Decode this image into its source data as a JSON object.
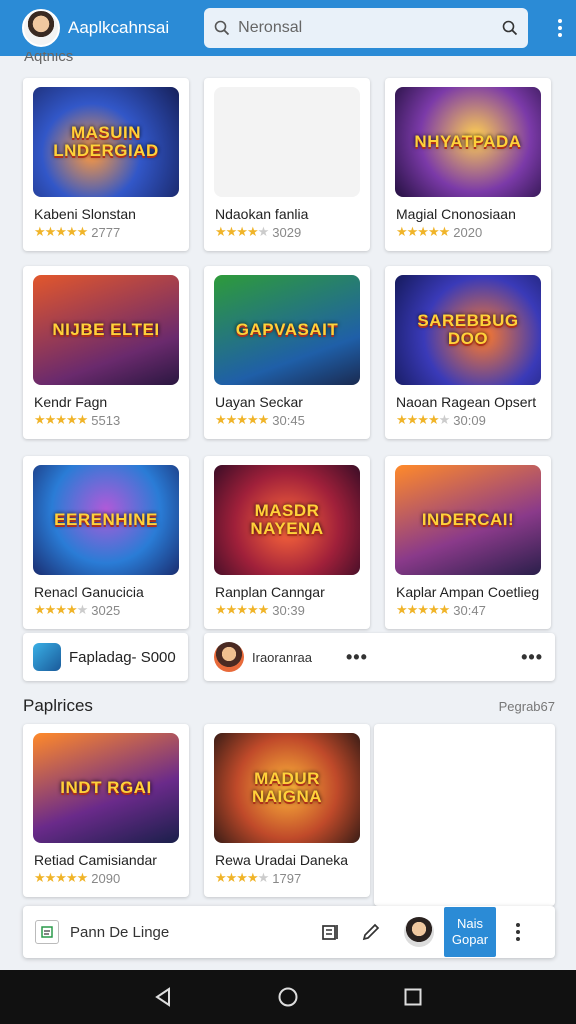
{
  "app": {
    "title": "Aaplkcahnsai"
  },
  "search": {
    "placeholder": "Neronsal"
  },
  "partial_section_title": "Aqtnics",
  "games": [
    {
      "thumb_text": "MASUIN LNDERGIAD",
      "name": "Kabeni Slonstan",
      "rating": 5,
      "count": "2777"
    },
    {
      "thumb_text": "",
      "name": "Ndaokan fanlia",
      "rating": 3.5,
      "count": "3029"
    },
    {
      "thumb_text": "NHYATPADA",
      "name": "Magial Cnonosiaan",
      "rating": 5,
      "count": "2020"
    },
    {
      "thumb_text": "NIJBE ELTEI",
      "name": "Kendr Fagn",
      "rating": 5,
      "count": "5513"
    },
    {
      "thumb_text": "GAPVASAIT",
      "name": "Uayan Seckar",
      "rating": 5,
      "count": "30:45"
    },
    {
      "thumb_text": "SAREBBUG DOO",
      "name": "Naoan Ragean Opsert",
      "rating": 3.5,
      "count": "30:09"
    },
    {
      "thumb_text": "EERENHINE",
      "name": "Renacl Ganucicia",
      "rating": 3.5,
      "count": "3025"
    },
    {
      "thumb_text": "MASDR NAYENA",
      "name": "Ranplan Canngar",
      "rating": 5,
      "count": "30:39"
    },
    {
      "thumb_text": "INDERCAI!",
      "name": "Kaplar Ampan Coetlieg",
      "rating": 5,
      "count": "30:47"
    }
  ],
  "overlay": {
    "left_label": "Fapladag- S000",
    "mid_label": "Iraoranraa"
  },
  "section2": {
    "title": "Paplrices",
    "link": "Pegrab67"
  },
  "games2": [
    {
      "thumb_text": "INDT RGAI",
      "name": "Retiad Camisiandar",
      "rating": 5,
      "count": "2090"
    },
    {
      "thumb_text": "MADUR NAIGNA",
      "name": "Rewa Uradai Daneka",
      "rating": 4,
      "count": "1797"
    }
  ],
  "bottom_bar": {
    "label": "Pann De Linge",
    "primary_button": "Nais Gopar"
  },
  "icons": {
    "search": "search-icon",
    "menu": "kebab-menu-icon",
    "back": "back-triangle-icon",
    "home": "home-circle-icon",
    "recents": "recents-square-icon"
  },
  "colors": {
    "accent": "#2b8bd6",
    "star": "#f0b429"
  }
}
